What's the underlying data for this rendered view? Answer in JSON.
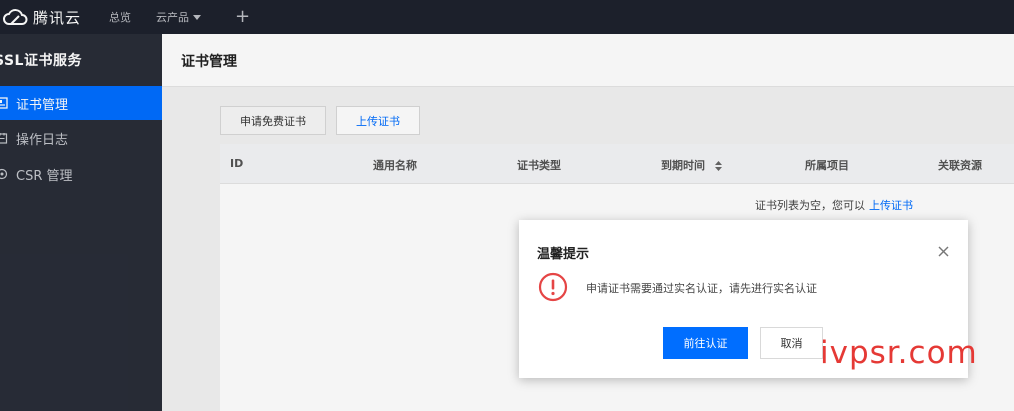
{
  "topbar": {
    "brand": "腾讯云",
    "nav_overview": "总览",
    "nav_products": "云产品",
    "plus": "+"
  },
  "sidebar": {
    "title": "SSL证书服务",
    "items": [
      {
        "label": "证书管理",
        "icon": "certificate-icon",
        "active": true
      },
      {
        "label": "操作日志",
        "icon": "log-icon",
        "active": false
      },
      {
        "label": "CSR 管理",
        "icon": "csr-icon",
        "active": false
      }
    ]
  },
  "page": {
    "title": "证书管理",
    "tabs": {
      "apply_free": "申请免费证书",
      "upload": "上传证书"
    },
    "table": {
      "columns": [
        "ID",
        "通用名称",
        "证书类型",
        "到期时间",
        "所属项目",
        "关联资源"
      ],
      "empty_text": "证书列表为空，您可以",
      "empty_link": "上传证书"
    }
  },
  "dialog": {
    "title": "温馨提示",
    "message": "申请证书需要通过实名认证，请先进行实名认证",
    "confirm": "前往认证",
    "cancel": "取消"
  },
  "watermark": "ivpsr.com",
  "colors": {
    "accent": "#006eff",
    "warning": "#e54545",
    "topbar_bg": "#1e222d",
    "sidebar_bg": "#292d38"
  }
}
